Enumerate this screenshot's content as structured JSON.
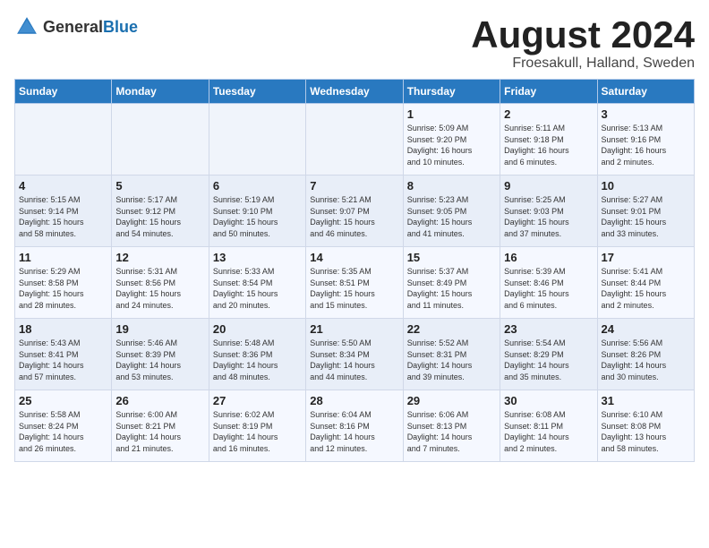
{
  "header": {
    "logo_general": "General",
    "logo_blue": "Blue",
    "month_title": "August 2024",
    "subtitle": "Froesakull, Halland, Sweden"
  },
  "days_of_week": [
    "Sunday",
    "Monday",
    "Tuesday",
    "Wednesday",
    "Thursday",
    "Friday",
    "Saturday"
  ],
  "weeks": [
    [
      {
        "num": "",
        "detail": ""
      },
      {
        "num": "",
        "detail": ""
      },
      {
        "num": "",
        "detail": ""
      },
      {
        "num": "",
        "detail": ""
      },
      {
        "num": "1",
        "detail": "Sunrise: 5:09 AM\nSunset: 9:20 PM\nDaylight: 16 hours\nand 10 minutes."
      },
      {
        "num": "2",
        "detail": "Sunrise: 5:11 AM\nSunset: 9:18 PM\nDaylight: 16 hours\nand 6 minutes."
      },
      {
        "num": "3",
        "detail": "Sunrise: 5:13 AM\nSunset: 9:16 PM\nDaylight: 16 hours\nand 2 minutes."
      }
    ],
    [
      {
        "num": "4",
        "detail": "Sunrise: 5:15 AM\nSunset: 9:14 PM\nDaylight: 15 hours\nand 58 minutes."
      },
      {
        "num": "5",
        "detail": "Sunrise: 5:17 AM\nSunset: 9:12 PM\nDaylight: 15 hours\nand 54 minutes."
      },
      {
        "num": "6",
        "detail": "Sunrise: 5:19 AM\nSunset: 9:10 PM\nDaylight: 15 hours\nand 50 minutes."
      },
      {
        "num": "7",
        "detail": "Sunrise: 5:21 AM\nSunset: 9:07 PM\nDaylight: 15 hours\nand 46 minutes."
      },
      {
        "num": "8",
        "detail": "Sunrise: 5:23 AM\nSunset: 9:05 PM\nDaylight: 15 hours\nand 41 minutes."
      },
      {
        "num": "9",
        "detail": "Sunrise: 5:25 AM\nSunset: 9:03 PM\nDaylight: 15 hours\nand 37 minutes."
      },
      {
        "num": "10",
        "detail": "Sunrise: 5:27 AM\nSunset: 9:01 PM\nDaylight: 15 hours\nand 33 minutes."
      }
    ],
    [
      {
        "num": "11",
        "detail": "Sunrise: 5:29 AM\nSunset: 8:58 PM\nDaylight: 15 hours\nand 28 minutes."
      },
      {
        "num": "12",
        "detail": "Sunrise: 5:31 AM\nSunset: 8:56 PM\nDaylight: 15 hours\nand 24 minutes."
      },
      {
        "num": "13",
        "detail": "Sunrise: 5:33 AM\nSunset: 8:54 PM\nDaylight: 15 hours\nand 20 minutes."
      },
      {
        "num": "14",
        "detail": "Sunrise: 5:35 AM\nSunset: 8:51 PM\nDaylight: 15 hours\nand 15 minutes."
      },
      {
        "num": "15",
        "detail": "Sunrise: 5:37 AM\nSunset: 8:49 PM\nDaylight: 15 hours\nand 11 minutes."
      },
      {
        "num": "16",
        "detail": "Sunrise: 5:39 AM\nSunset: 8:46 PM\nDaylight: 15 hours\nand 6 minutes."
      },
      {
        "num": "17",
        "detail": "Sunrise: 5:41 AM\nSunset: 8:44 PM\nDaylight: 15 hours\nand 2 minutes."
      }
    ],
    [
      {
        "num": "18",
        "detail": "Sunrise: 5:43 AM\nSunset: 8:41 PM\nDaylight: 14 hours\nand 57 minutes."
      },
      {
        "num": "19",
        "detail": "Sunrise: 5:46 AM\nSunset: 8:39 PM\nDaylight: 14 hours\nand 53 minutes."
      },
      {
        "num": "20",
        "detail": "Sunrise: 5:48 AM\nSunset: 8:36 PM\nDaylight: 14 hours\nand 48 minutes."
      },
      {
        "num": "21",
        "detail": "Sunrise: 5:50 AM\nSunset: 8:34 PM\nDaylight: 14 hours\nand 44 minutes."
      },
      {
        "num": "22",
        "detail": "Sunrise: 5:52 AM\nSunset: 8:31 PM\nDaylight: 14 hours\nand 39 minutes."
      },
      {
        "num": "23",
        "detail": "Sunrise: 5:54 AM\nSunset: 8:29 PM\nDaylight: 14 hours\nand 35 minutes."
      },
      {
        "num": "24",
        "detail": "Sunrise: 5:56 AM\nSunset: 8:26 PM\nDaylight: 14 hours\nand 30 minutes."
      }
    ],
    [
      {
        "num": "25",
        "detail": "Sunrise: 5:58 AM\nSunset: 8:24 PM\nDaylight: 14 hours\nand 26 minutes."
      },
      {
        "num": "26",
        "detail": "Sunrise: 6:00 AM\nSunset: 8:21 PM\nDaylight: 14 hours\nand 21 minutes."
      },
      {
        "num": "27",
        "detail": "Sunrise: 6:02 AM\nSunset: 8:19 PM\nDaylight: 14 hours\nand 16 minutes."
      },
      {
        "num": "28",
        "detail": "Sunrise: 6:04 AM\nSunset: 8:16 PM\nDaylight: 14 hours\nand 12 minutes."
      },
      {
        "num": "29",
        "detail": "Sunrise: 6:06 AM\nSunset: 8:13 PM\nDaylight: 14 hours\nand 7 minutes."
      },
      {
        "num": "30",
        "detail": "Sunrise: 6:08 AM\nSunset: 8:11 PM\nDaylight: 14 hours\nand 2 minutes."
      },
      {
        "num": "31",
        "detail": "Sunrise: 6:10 AM\nSunset: 8:08 PM\nDaylight: 13 hours\nand 58 minutes."
      }
    ]
  ]
}
